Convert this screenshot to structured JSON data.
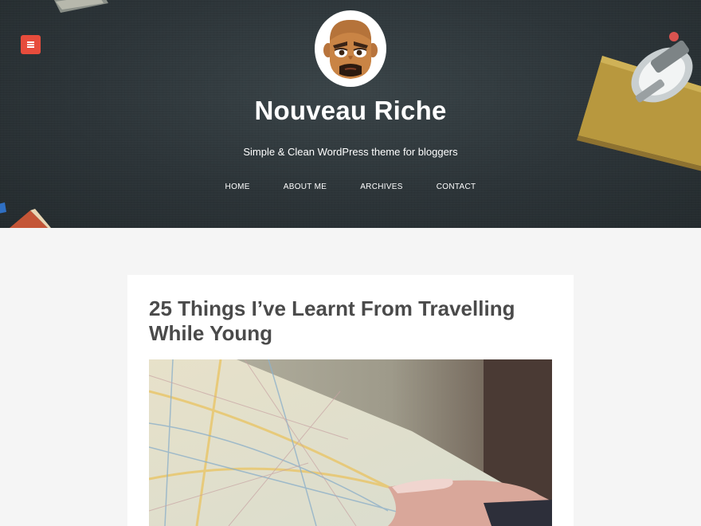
{
  "header": {
    "site_title": "Nouveau Riche",
    "tagline": "Simple & Clean WordPress theme for bloggers",
    "menu_icon": "hamburger-menu-icon",
    "nav": [
      {
        "label": "HOME"
      },
      {
        "label": "ABOUT ME"
      },
      {
        "label": "ARCHIVES"
      },
      {
        "label": "CONTACT"
      }
    ]
  },
  "post": {
    "title": "25 Things I’ve Learnt From Travelling While Young",
    "image_alt": "hands holding a city map"
  },
  "colors": {
    "accent": "#e74c3c",
    "header_bg": "#2c3438",
    "page_bg": "#f5f5f5",
    "title_text": "#4a4a4a"
  }
}
